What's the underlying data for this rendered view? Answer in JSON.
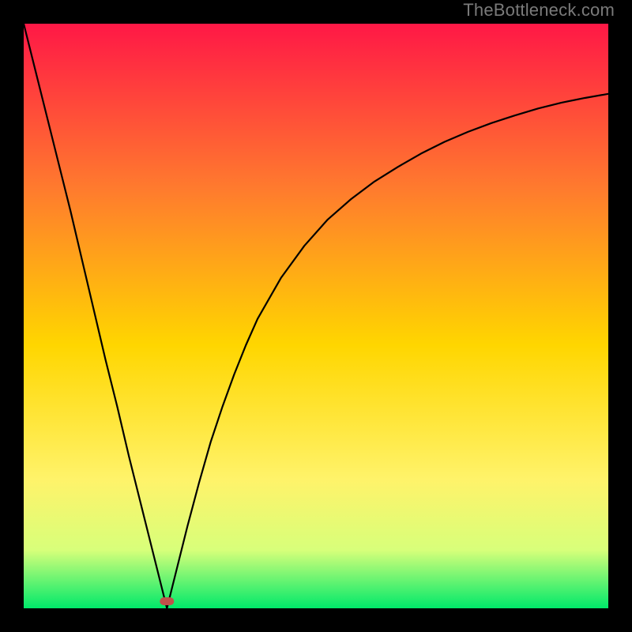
{
  "watermark": "TheBottleneck.com",
  "colors": {
    "gradient_top": "#ff1846",
    "gradient_mid_upper": "#ff7a2e",
    "gradient_mid": "#ffd600",
    "gradient_mid_lower": "#fff36a",
    "gradient_lower": "#d8ff7a",
    "gradient_bottom": "#00e96a",
    "curve": "#000000",
    "marker": "#c1514a",
    "frame": "#000000"
  },
  "chart_data": {
    "type": "line",
    "title": "",
    "xlabel": "",
    "ylabel": "",
    "xlim": [
      0,
      100
    ],
    "ylim": [
      0,
      100
    ],
    "grid": false,
    "legend": false,
    "notes": "V-shaped bottleneck curve. Minimum at approximately x≈24.5, y≈0. Left branch nearly linear from (0,100) to minimum; right branch rises concave-down toward (100,≈88). Background is vertical gradient red→green (top→bottom). Small rounded marker at curve minimum.",
    "minimum": {
      "x": 24.5,
      "y": 0
    },
    "x": [
      0,
      2,
      4,
      6,
      8,
      10,
      12,
      14,
      16,
      18,
      20,
      22,
      24.5,
      26,
      28,
      30,
      32,
      34,
      36,
      38,
      40,
      44,
      48,
      52,
      56,
      60,
      64,
      68,
      72,
      76,
      80,
      84,
      88,
      92,
      96,
      100
    ],
    "values": [
      100,
      92,
      84,
      76,
      68,
      59.5,
      51,
      42.5,
      34.5,
      26,
      18,
      10,
      0,
      6,
      14,
      21.5,
      28.5,
      34.5,
      40,
      45,
      49.5,
      56.5,
      62,
      66.5,
      70,
      73,
      75.5,
      77.8,
      79.8,
      81.5,
      83,
      84.3,
      85.5,
      86.5,
      87.3,
      88
    ],
    "marker": {
      "x": 24.5,
      "y": 1.2
    }
  }
}
